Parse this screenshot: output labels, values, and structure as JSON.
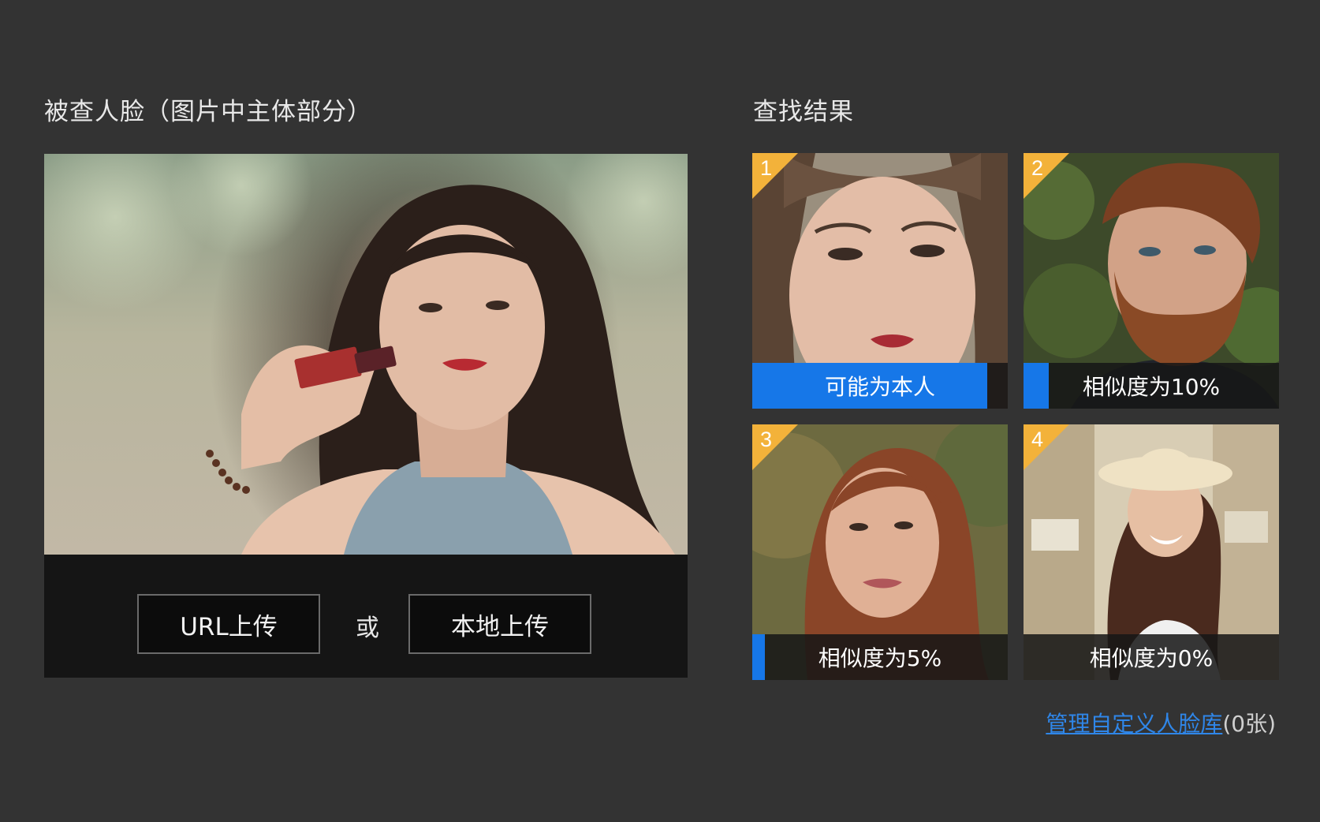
{
  "query": {
    "heading": "被查人脸（图片中主体部分）",
    "url_upload_label": "URL上传",
    "or_label": "或",
    "local_upload_label": "本地上传"
  },
  "results": {
    "heading": "查找结果",
    "items": [
      {
        "rank": "1",
        "label": "可能为本人",
        "similarity_fill": 0.92
      },
      {
        "rank": "2",
        "label": "相似度为10%",
        "similarity_fill": 0.1
      },
      {
        "rank": "3",
        "label": "相似度为5%",
        "similarity_fill": 0.05
      },
      {
        "rank": "4",
        "label": "相似度为0%",
        "similarity_fill": 0.0
      }
    ],
    "manage_link": "管理自定义人脸库",
    "manage_count": "(0张)"
  },
  "colors": {
    "background": "#333333",
    "accent_blue": "#1677e8",
    "badge_yellow": "#f3b23a",
    "link_blue": "#2f86e8"
  }
}
